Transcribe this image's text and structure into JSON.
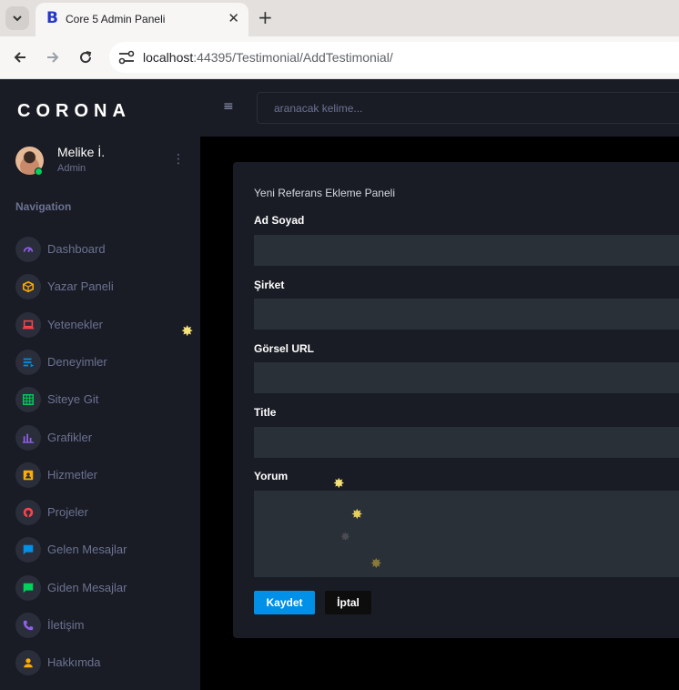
{
  "browser": {
    "tab_title": "Core 5 Admin Paneli",
    "tab_favicon": "B",
    "url_host": "localhost",
    "url_rest": ":44395/Testimonial/AddTestimonial/"
  },
  "brand": "CORONA",
  "profile": {
    "name": "Melike İ.",
    "role": "Admin"
  },
  "nav_caption": "Navigation",
  "nav": [
    {
      "label": "Dashboard",
      "icon": "speedometer-icon",
      "color": "#8f5fe8"
    },
    {
      "label": "Yazar Paneli",
      "icon": "cube-icon",
      "color": "#ffab00"
    },
    {
      "label": "Yetenekler",
      "icon": "laptop-icon",
      "color": "#fc424a"
    },
    {
      "label": "Deneyimler",
      "icon": "playlist-icon",
      "color": "#0090e7"
    },
    {
      "label": "Siteye Git",
      "icon": "table-icon",
      "color": "#00d25b"
    },
    {
      "label": "Grafikler",
      "icon": "chart-bar-icon",
      "color": "#8f5fe8"
    },
    {
      "label": "Hizmetler",
      "icon": "contacts-icon",
      "color": "#ffab00"
    },
    {
      "label": "Projeler",
      "icon": "github-icon",
      "color": "#fc424a"
    },
    {
      "label": "Gelen Mesajlar",
      "icon": "message-icon",
      "color": "#0090e7"
    },
    {
      "label": "Giden Mesajlar",
      "icon": "message-icon",
      "color": "#00d25b"
    },
    {
      "label": "İletişim",
      "icon": "phone-icon",
      "color": "#8f5fe8"
    },
    {
      "label": "Hakkımda",
      "icon": "account-icon",
      "color": "#ffab00"
    }
  ],
  "search": {
    "placeholder": "aranacak kelime..."
  },
  "form": {
    "title": "Yeni Referans Ekleme Paneli",
    "fields": [
      {
        "label": "Ad Soyad",
        "value": ""
      },
      {
        "label": "Şirket",
        "value": ""
      },
      {
        "label": "Görsel URL",
        "value": ""
      },
      {
        "label": "Title",
        "value": ""
      },
      {
        "label": "Yorum",
        "value": ""
      }
    ],
    "save_label": "Kaydet",
    "cancel_label": "İptal"
  }
}
